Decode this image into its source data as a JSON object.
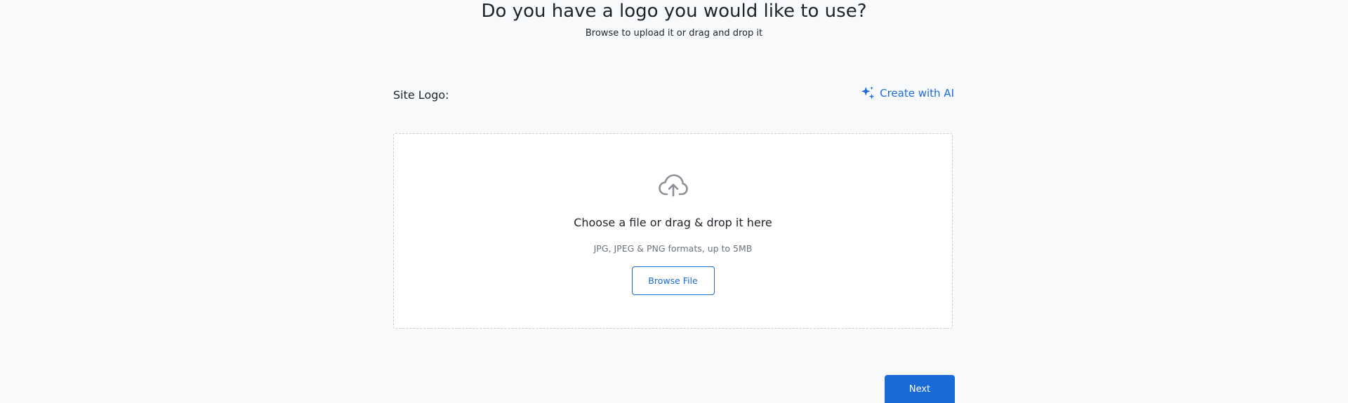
{
  "header": {
    "title": "Do you have a logo you would like to use?",
    "subtitle": "Browse to upload it or drag and drop it"
  },
  "logo_section": {
    "label": "Site Logo:",
    "create_ai_label": "Create with AI",
    "create_ai_icon": "sparkles-icon"
  },
  "dropzone": {
    "icon": "cloud-upload-icon",
    "prompt": "Choose a file or drag & drop it here",
    "formats": "JPG, JPEG & PNG formats, up to 5MB",
    "browse_label": "Browse File"
  },
  "footer": {
    "next_label": "Next"
  },
  "colors": {
    "accent": "#1a6ad9",
    "background": "#f8f9fb",
    "text": "#1f2329",
    "muted": "#6b7280",
    "border": "#c9ccd1"
  }
}
